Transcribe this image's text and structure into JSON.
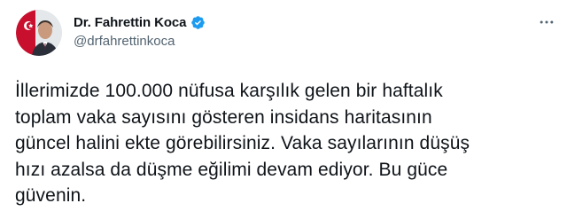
{
  "author": {
    "display_name": "Dr. Fahrettin Koca",
    "handle": "@drfahrettinkoca",
    "verified_icon": "verified-badge-icon",
    "avatar_icon": "profile-avatar-icon"
  },
  "tweet": {
    "text": "İllerimizde 100.000 nüfusa karşılık gelen bir haftalık\ntoplam vaka sayısını gösteren insidans haritasının\ngüncel halini ekte görebilirsiniz. Vaka sayılarının düşüş\nhızı azalsa da düşme eğilimi devam ediyor. Bu güce\ngüvenin."
  },
  "colors": {
    "text_primary": "#0f1419",
    "text_secondary": "#536471",
    "verified_blue": "#1d9bf0",
    "background": "#ffffff"
  }
}
